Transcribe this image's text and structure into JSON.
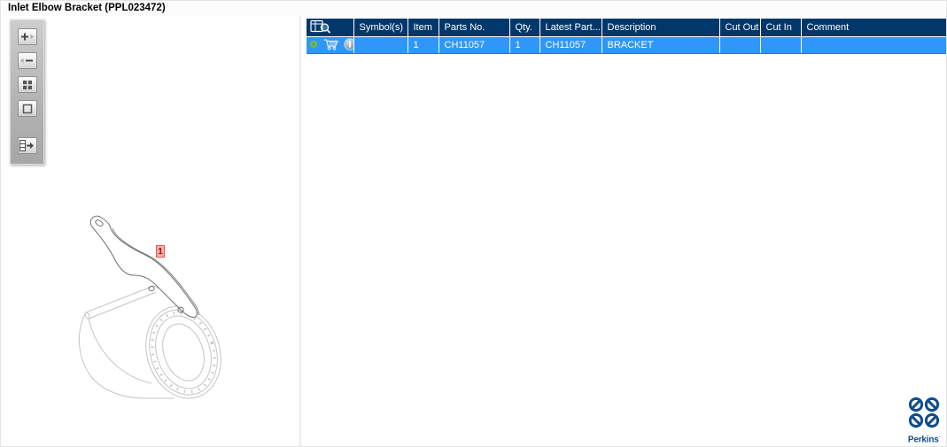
{
  "window": {
    "title": "Inlet Elbow Bracket (PPL023472)"
  },
  "toolbar": {
    "buttons": [
      {
        "name": "zoom-in",
        "icon": "plus-arrow-icon"
      },
      {
        "name": "zoom-out",
        "icon": "minus-arrow-icon"
      },
      {
        "name": "tile-view",
        "icon": "four-squares-icon"
      },
      {
        "name": "fit-to-window",
        "icon": "square-icon"
      },
      {
        "name": "toggle-parts-list",
        "icon": "list-arrow-icon"
      }
    ]
  },
  "diagram": {
    "callout_label": "1",
    "selected_item": "1"
  },
  "parts_table": {
    "header_icon": "table-search-icon",
    "columns": [
      "",
      "Symbol(s)",
      "Item",
      "Parts No.",
      "Qty.",
      "Latest Part...",
      "Description",
      "Cut Out",
      "Cut In",
      "Comment"
    ],
    "rows": [
      {
        "row_icons": [
          "gear-icon",
          "cart-icon",
          "info-icon"
        ],
        "symbols": "",
        "item": "1",
        "parts_no": "CH11057",
        "qty": "1",
        "latest_part": "CH11057",
        "description": "BRACKET",
        "cut_out": "",
        "cut_in": "",
        "comment": "",
        "selected": true
      }
    ]
  },
  "branding": {
    "name": "Perkins",
    "reg_mark": "·"
  },
  "colors": {
    "header_bg": "#00386b",
    "selected_row_bg": "#3096fa",
    "brand_blue": "#0f4c8f",
    "callout_red": "#df5a52",
    "gear_green": "#7cb82f"
  }
}
